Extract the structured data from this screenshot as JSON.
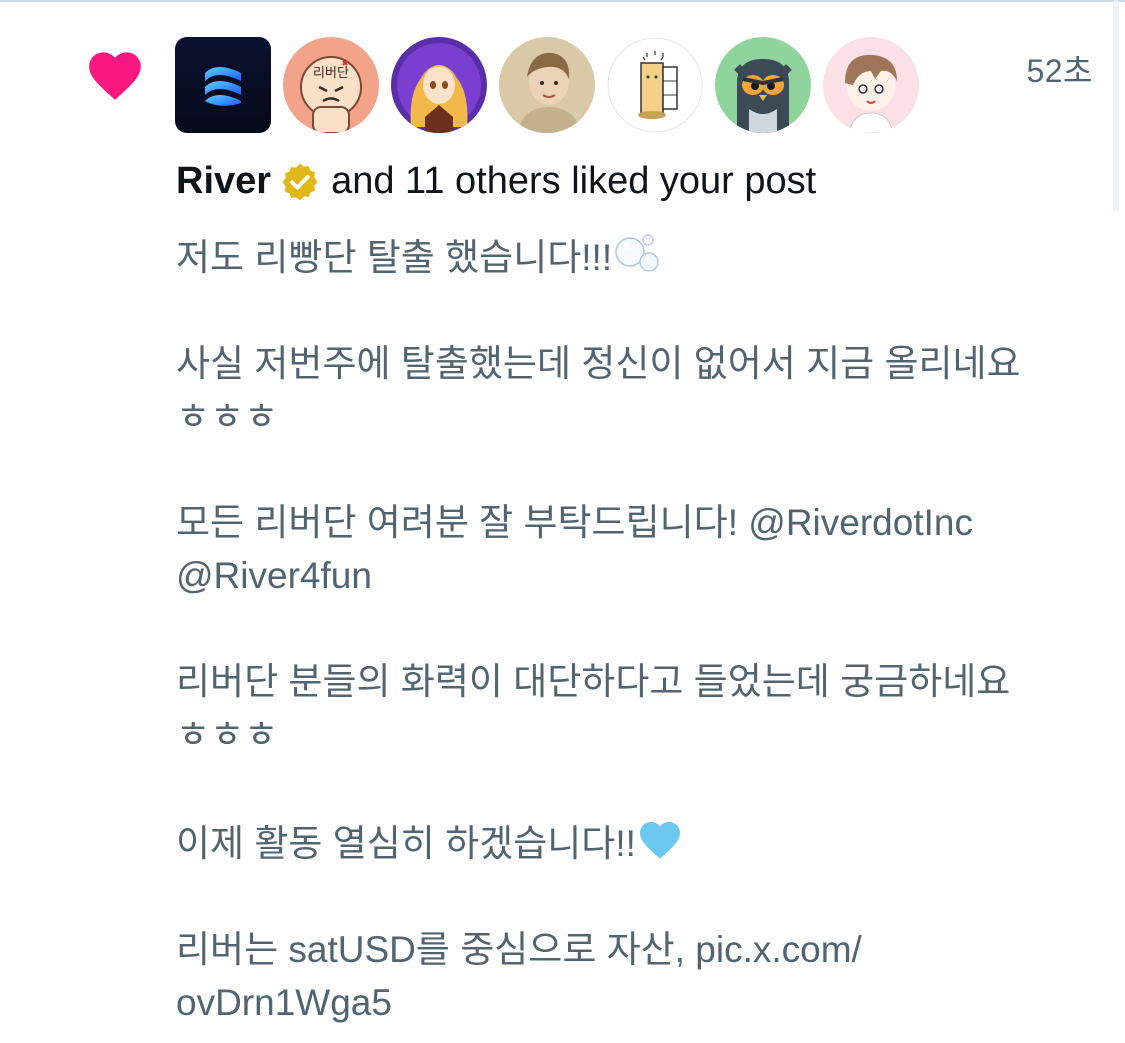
{
  "notification": {
    "timestamp": "52초",
    "actor_name": "River",
    "liked_text": "and 11 others liked your post"
  },
  "avatars": [
    {
      "name": "river-logo"
    },
    {
      "name": "angry-bread-character",
      "text": "리버단"
    },
    {
      "name": "anime-girl"
    },
    {
      "name": "person-photo"
    },
    {
      "name": "drawing-character"
    },
    {
      "name": "owl-character"
    },
    {
      "name": "chibi-boy"
    }
  ],
  "post": {
    "line1": "저도 리빵단 탈출 했습니다!!!",
    "line2": "사실 저번주에 탈출했는데 정신이 없어서 지금 올리네요",
    "line3": "ㅎㅎㅎ",
    "line4": "모든 리버단 여려분 잘 부탁드립니다! @RiverdotInc",
    "line5": "@River4fun",
    "line6": "리버단 분들의 화력이 대단하다고 들었는데 궁금하네요",
    "line7": "ㅎㅎㅎ",
    "line8": "이제 활동 열심히 하겠습니다!!",
    "line9": "리버는 satUSD를 중심으로 자산, pic.x.com/",
    "line10": "ovDrn1Wga5"
  },
  "colors": {
    "heart": "#f91880",
    "body_text": "#536471",
    "title_text": "#0f1419",
    "badge": "#e2b719"
  }
}
